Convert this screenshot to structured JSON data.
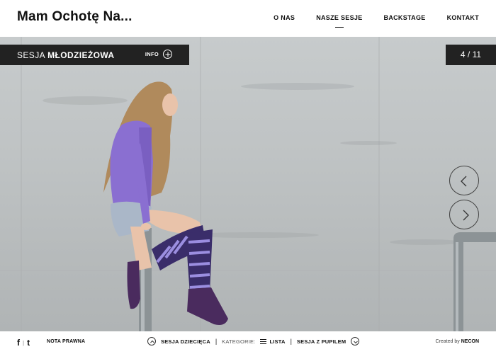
{
  "header": {
    "logo": "Mam Ochotę Na...",
    "nav": [
      {
        "label": "O NAS"
      },
      {
        "label": "NASZE SESJE",
        "active": true
      },
      {
        "label": "BACKSTAGE"
      },
      {
        "label": "KONTAKT"
      }
    ]
  },
  "session": {
    "title_prefix": "SESJA",
    "title_bold": "MŁODZIEŻOWA",
    "info_label": "INFO",
    "counter": "4 / 11"
  },
  "footer": {
    "social": {
      "facebook": "f",
      "separator": "|",
      "tumblr": "t"
    },
    "legal": "NOTA PRAWNA",
    "prev_session": "SESJA DZIECIĘCA",
    "categories_label": "KATEGORIE:",
    "list_label": "LISTA",
    "next_session": "SESJA Z PUPILEM",
    "credit_prefix": "Created by",
    "credit_name": "NECON"
  },
  "icons": {
    "info": "plus-circle-icon",
    "prev": "chevron-left-icon",
    "next": "chevron-right-icon",
    "footer_prev": "chevron-up-icon",
    "footer_next": "chevron-down-icon",
    "list": "list-icon"
  },
  "colors": {
    "bar": "#222222",
    "accent_purple": "#8a6fd1",
    "concrete": "#bfc3c4"
  }
}
